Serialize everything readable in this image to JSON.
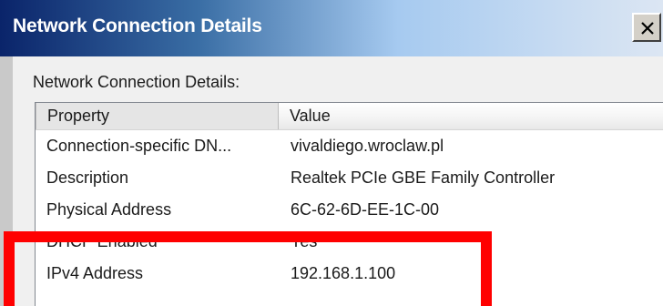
{
  "window": {
    "title": "Network Connection Details",
    "close_symbol": "close-icon"
  },
  "group": {
    "label": "Network Connection Details:"
  },
  "listview": {
    "columns": [
      "Property",
      "Value"
    ],
    "rows": [
      {
        "property": "Connection-specific DN...",
        "value": "vivaldiego.wroclaw.pl"
      },
      {
        "property": "Description",
        "value": "Realtek PCIe GBE Family Controller"
      },
      {
        "property": "Physical Address",
        "value": "6C-62-6D-EE-1C-00"
      },
      {
        "property": "DHCP Enabled",
        "value": "Yes"
      },
      {
        "property": "IPv4 Address",
        "value": "192.168.1.100"
      }
    ]
  },
  "colors": {
    "highlight": "#ff0000",
    "titlebar_start": "#0a246a",
    "titlebar_end": "#dce6f3"
  }
}
